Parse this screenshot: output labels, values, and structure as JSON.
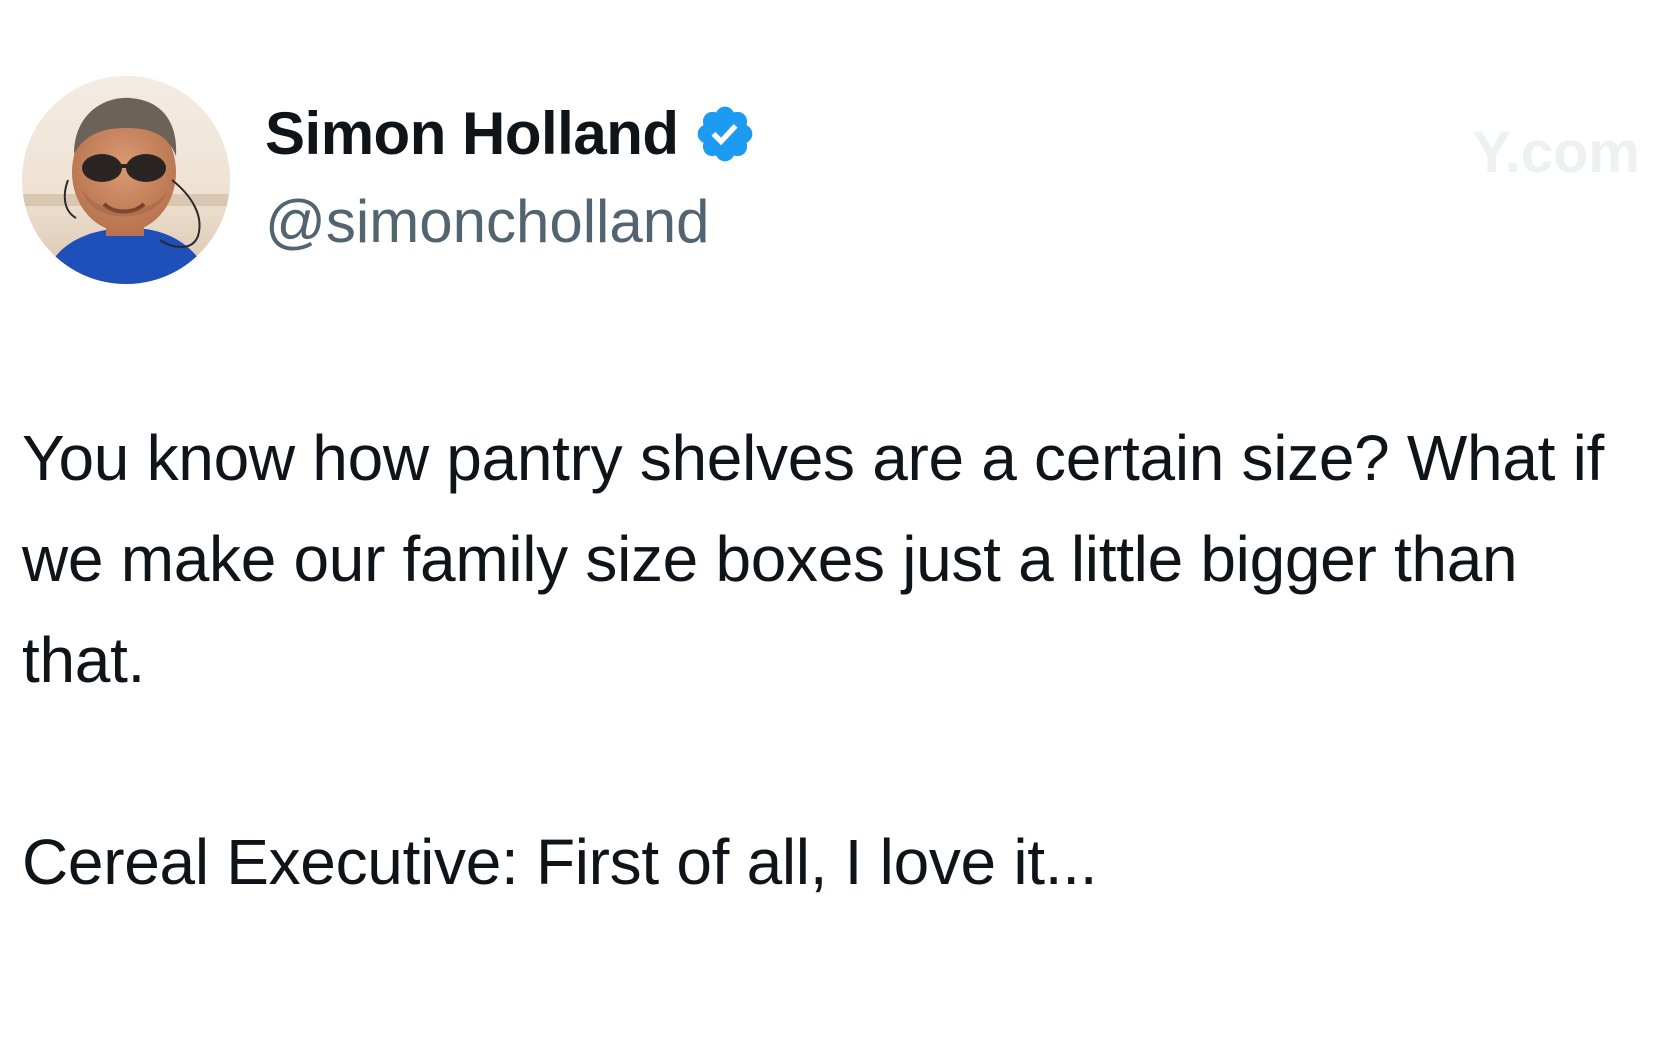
{
  "author": {
    "display_name": "Simon Holland",
    "handle": "@simoncholland",
    "verified": true,
    "verified_badge_color": "#1d9bf0",
    "avatar_icon": "profile-photo-man-sunglasses"
  },
  "watermark": {
    "text": "Y.com"
  },
  "tweet": {
    "paragraph_1": "You know how pantry shelves are a certain size? What if we make our family size boxes just a little bigger than that.",
    "paragraph_2": "Cereal Executive: First of all, I love it..."
  },
  "colors": {
    "text_primary": "#0f1419",
    "text_secondary": "#536471",
    "background": "#ffffff"
  }
}
